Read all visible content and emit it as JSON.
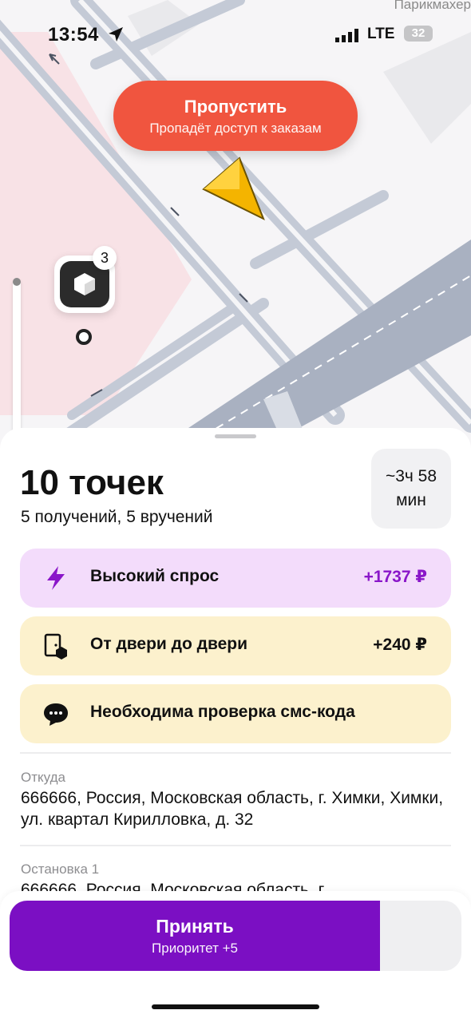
{
  "status_bar": {
    "time": "13:54",
    "network": "LTE",
    "battery": "32"
  },
  "map": {
    "corner_label": "Парикмахер",
    "pin_badge_count": "3"
  },
  "skip_button": {
    "title": "Пропустить",
    "subtitle": "Пропадёт доступ к заказам"
  },
  "order": {
    "points_title": "10 точек",
    "points_subtitle": "5 получений, 5 вручений",
    "duration_line1": "~3ч 58",
    "duration_line2": "мин"
  },
  "cards": {
    "demand": {
      "label": "Высокий спрос",
      "value": "+1737 ₽",
      "color": "#8a16c9",
      "icon": "lightning-icon"
    },
    "door": {
      "label": "От двери до двери",
      "value": "+240 ₽",
      "color": "#111111",
      "icon": "door-box-icon"
    },
    "sms": {
      "label": "Необходима проверка смс-кода",
      "icon": "chat-bubble-icon"
    }
  },
  "route": {
    "from_label": "Откуда",
    "from_address": "666666, Россия, Московская область, г. Химки, Химки, ул. квартал Кирилловка, д. 32",
    "stop1_label": "Остановка 1",
    "stop1_address": "666666, Россия, Московская область, г."
  },
  "accept_button": {
    "title": "Принять",
    "subtitle": "Приоритет +5",
    "progress_fraction": 0.82,
    "accent_color": "#7b0fc3"
  }
}
